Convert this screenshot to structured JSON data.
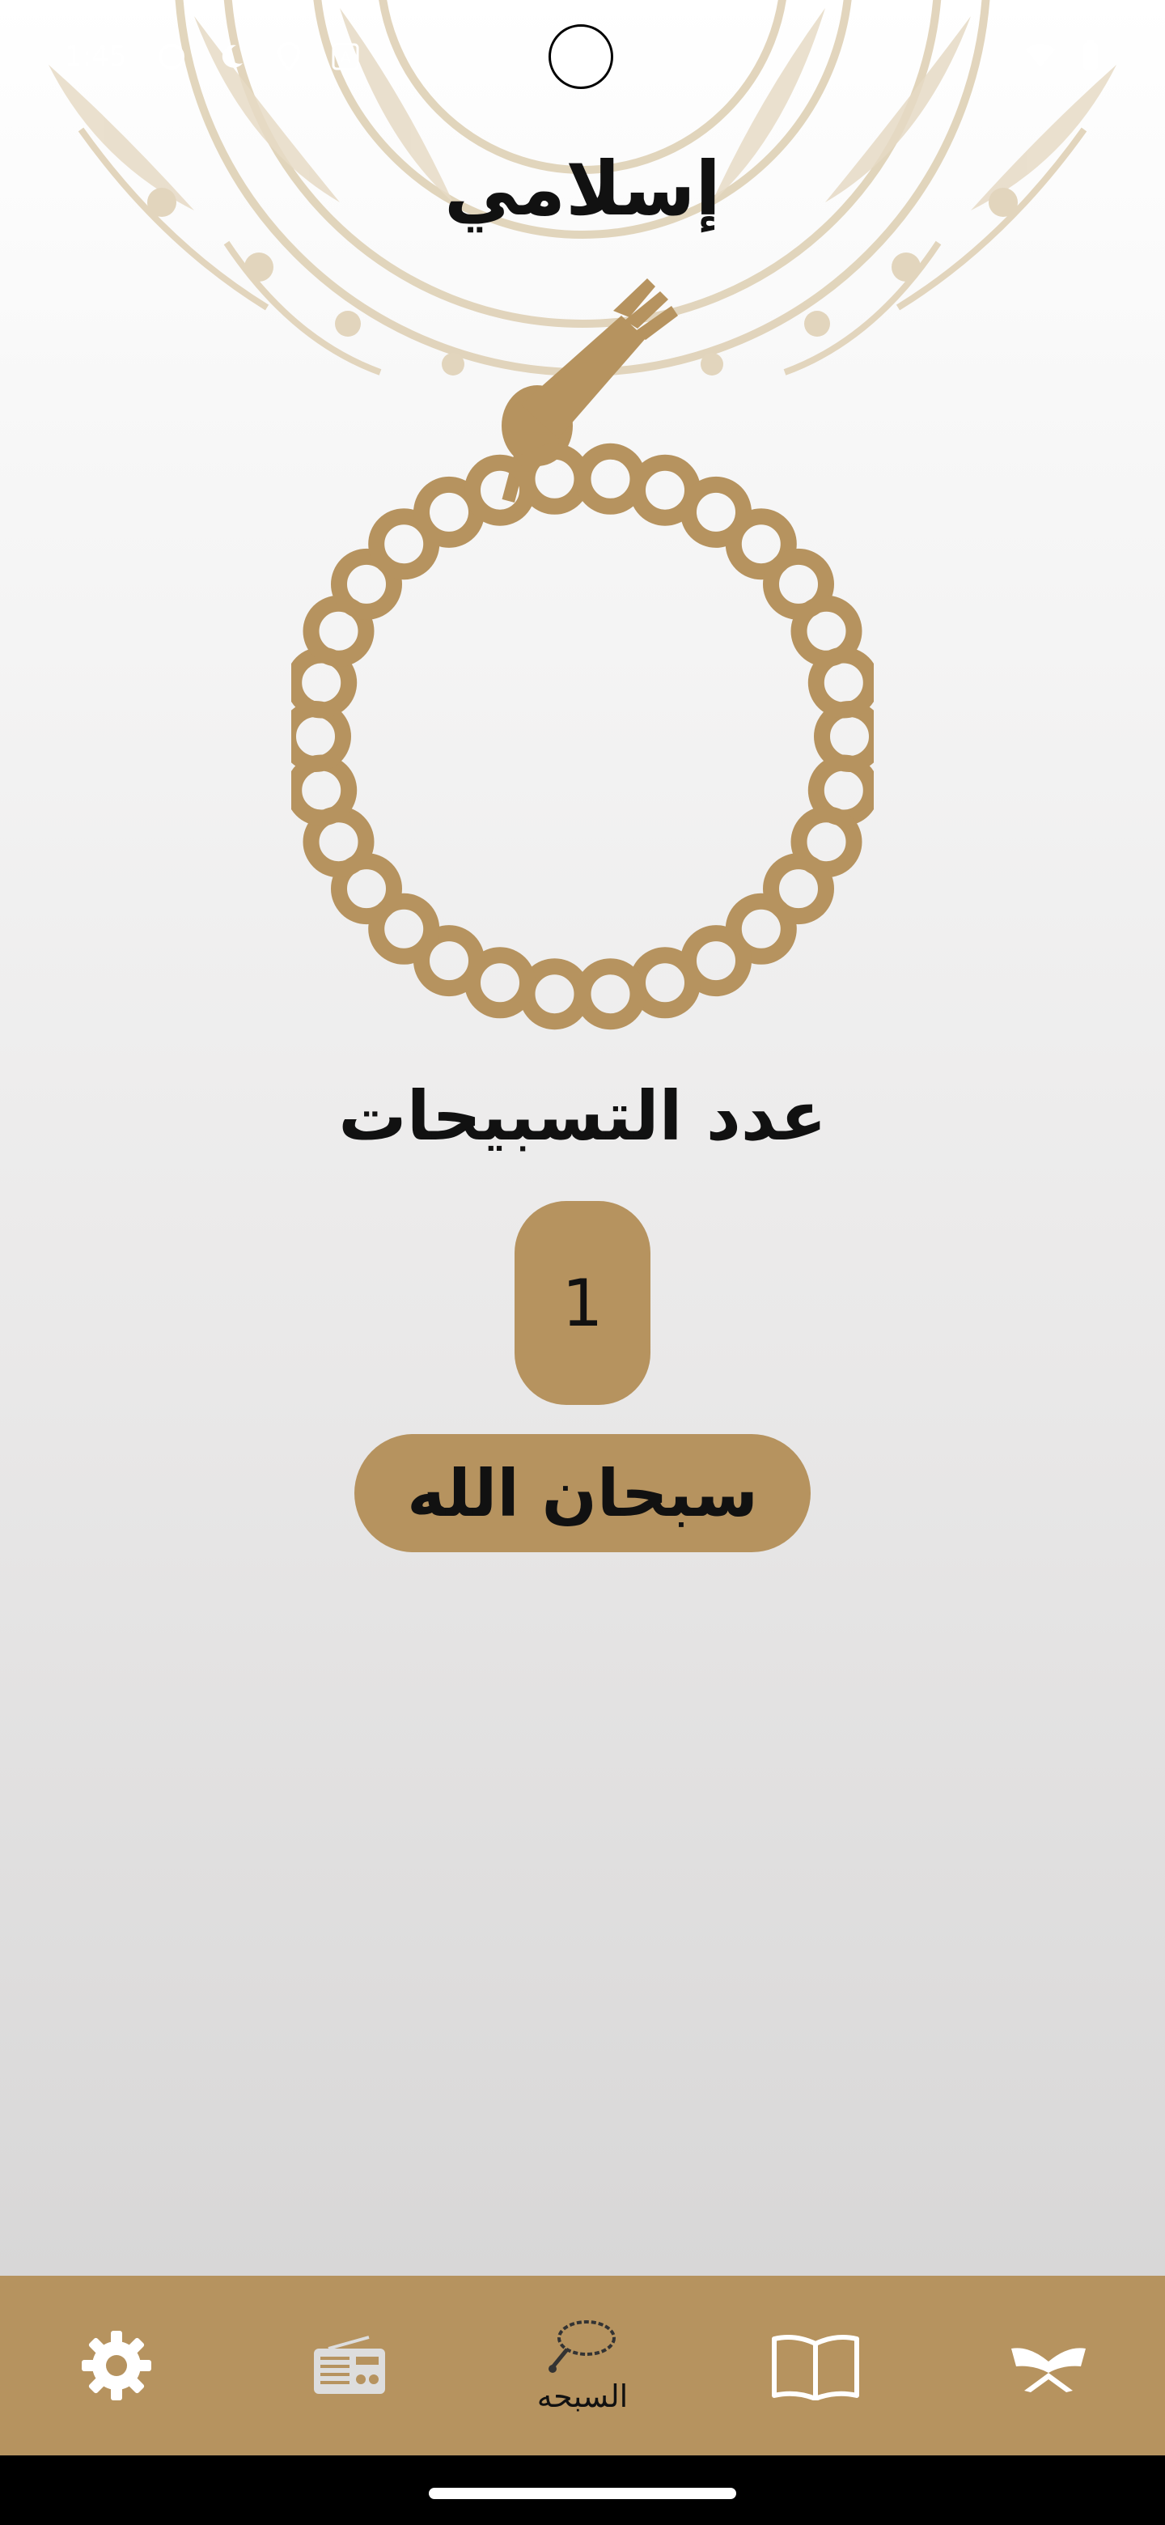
{
  "app": {
    "title": "إسلامي"
  },
  "status_bar": {
    "time": "1:45"
  },
  "tasbeeh": {
    "count_label": "عدد التسبيحات",
    "count": "1",
    "zikr": "سبحان الله"
  },
  "bottom_nav": {
    "items": [
      {
        "icon": "settings-gear-icon",
        "label": ""
      },
      {
        "icon": "radio-icon",
        "label": ""
      },
      {
        "icon": "sebha-icon",
        "label": "السبحه",
        "active": true
      },
      {
        "icon": "hadith-book-icon",
        "label": ""
      },
      {
        "icon": "quran-icon",
        "label": ""
      }
    ]
  },
  "colors": {
    "accent": "#b6935f",
    "mandala": "#e3d6bf"
  }
}
